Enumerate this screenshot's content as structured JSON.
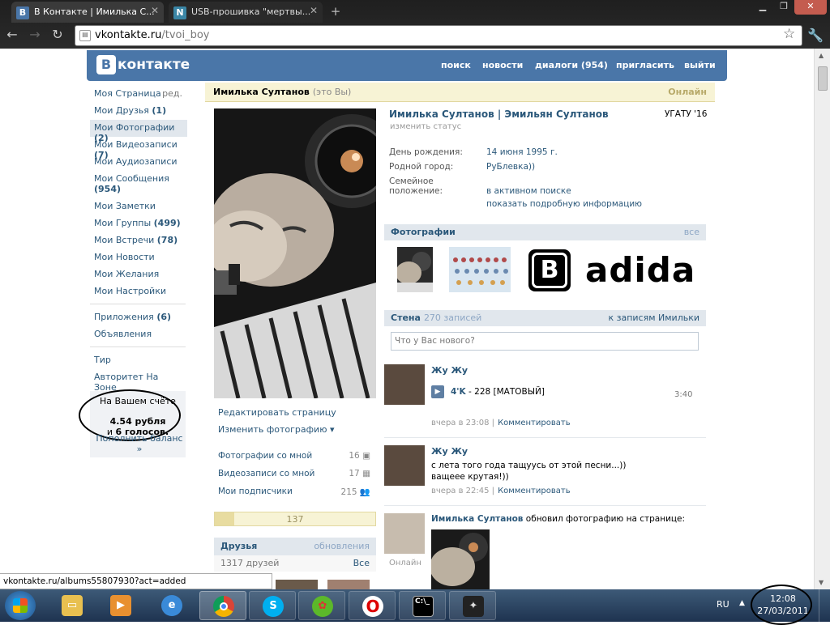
{
  "browser": {
    "tabs": [
      {
        "title": "В Контакте | Имилька С...",
        "favicon": "В"
      },
      {
        "title": "USB-прошивка \"мертвы...",
        "favicon": "N"
      }
    ],
    "new_tab": "+",
    "url_host": "vkontakte.ru",
    "url_path": "/tvoi_boy",
    "status_url": "vkontakte.ru/albums55807930?act=added"
  },
  "vk": {
    "logo_letter": "В",
    "logo_text": "контакте",
    "nav": {
      "search": "поиск",
      "news": "новости",
      "dialogs": "диалоги (954)",
      "invite": "пригласить",
      "logout": "выйти"
    },
    "menu": {
      "page": "Моя Страница",
      "edit": "ред.",
      "friends": "Мои Друзья",
      "friends_cnt": "(1)",
      "photos": "Мои Фотографии",
      "photos_cnt": "(2)",
      "videos": "Мои Видеозаписи",
      "videos_cnt": "(7)",
      "audio": "Мои Аудиозаписи",
      "messages": "Мои Сообщения",
      "messages_cnt": "(954)",
      "notes": "Мои Заметки",
      "groups": "Мои Группы",
      "groups_cnt": "(499)",
      "events": "Мои Встречи",
      "events_cnt": "(78)",
      "news": "Мои Новости",
      "wishes": "Мои Желания",
      "settings": "Мои Настройки",
      "apps": "Приложения",
      "apps_cnt": "(6)",
      "ads": "Объявления",
      "tir": "Тир",
      "avtoritet": "Авторитет На Зоне"
    },
    "balance": {
      "label": "На Вашем счёте",
      "amount": "4.54 рубля",
      "votes_pre": "и",
      "votes": "6 голосов.",
      "topup": "Пополнить баланс »"
    },
    "profile": {
      "name": "Имилька Султанов",
      "me": "(это Вы)",
      "online": "Онлайн",
      "full_name": "Имилька Султанов | Эмильян Султанов",
      "university": "УГАТУ '16",
      "change_status": "изменить статус",
      "birthday_k": "День рождения:",
      "birthday_v": "14 июня 1995 г.",
      "city_k": "Родной город:",
      "city_v": "РуБлевка))",
      "family_k": "Семейное положение:",
      "family_v": "в активном поиске",
      "more": "показать подробную информацию"
    },
    "avatar_links": {
      "edit": "Редактировать страницу",
      "change_photo": "Изменить фотографию ▾",
      "photos_with_me": "Фотографии со мной",
      "photos_with_me_n": "16",
      "videos_with_me": "Видеозаписи со мной",
      "videos_with_me_n": "17",
      "subscribers": "Мои подписчики",
      "subscribers_n": "215"
    },
    "rating": {
      "value": "137",
      "fill": 0.12
    },
    "friends": {
      "title": "Друзья",
      "updates": "обновления",
      "count": "1317 друзей",
      "all": "Все"
    },
    "photos_block": {
      "title": "Фотографии",
      "all": "все"
    },
    "wall": {
      "title": "Стена",
      "count": "270 записей",
      "to_posts": "к записям Имильки",
      "placeholder": "Что у Вас нового?",
      "posts": [
        {
          "author": "Жу Жу",
          "audio_artist": "4'K",
          "audio_title": " - 228 [МАТОВЫЙ]",
          "audio_time": "3:40",
          "time": "вчера в 23:08",
          "comment": "Комментировать"
        },
        {
          "author": "Жу Жу",
          "line1": "с лета того года тащуусь от этой песни...))",
          "line2": "ващеее крутая!))",
          "time": "вчера в 22:45",
          "comment": "Комментировать"
        },
        {
          "author": "Имилька Султанов",
          "text": " обновил фотографию на странице:",
          "online": "Онлайн"
        }
      ]
    },
    "adidas_text": "adida"
  },
  "taskbar": {
    "lang": "RU",
    "time": "12:08",
    "date": "27/03/2011"
  }
}
